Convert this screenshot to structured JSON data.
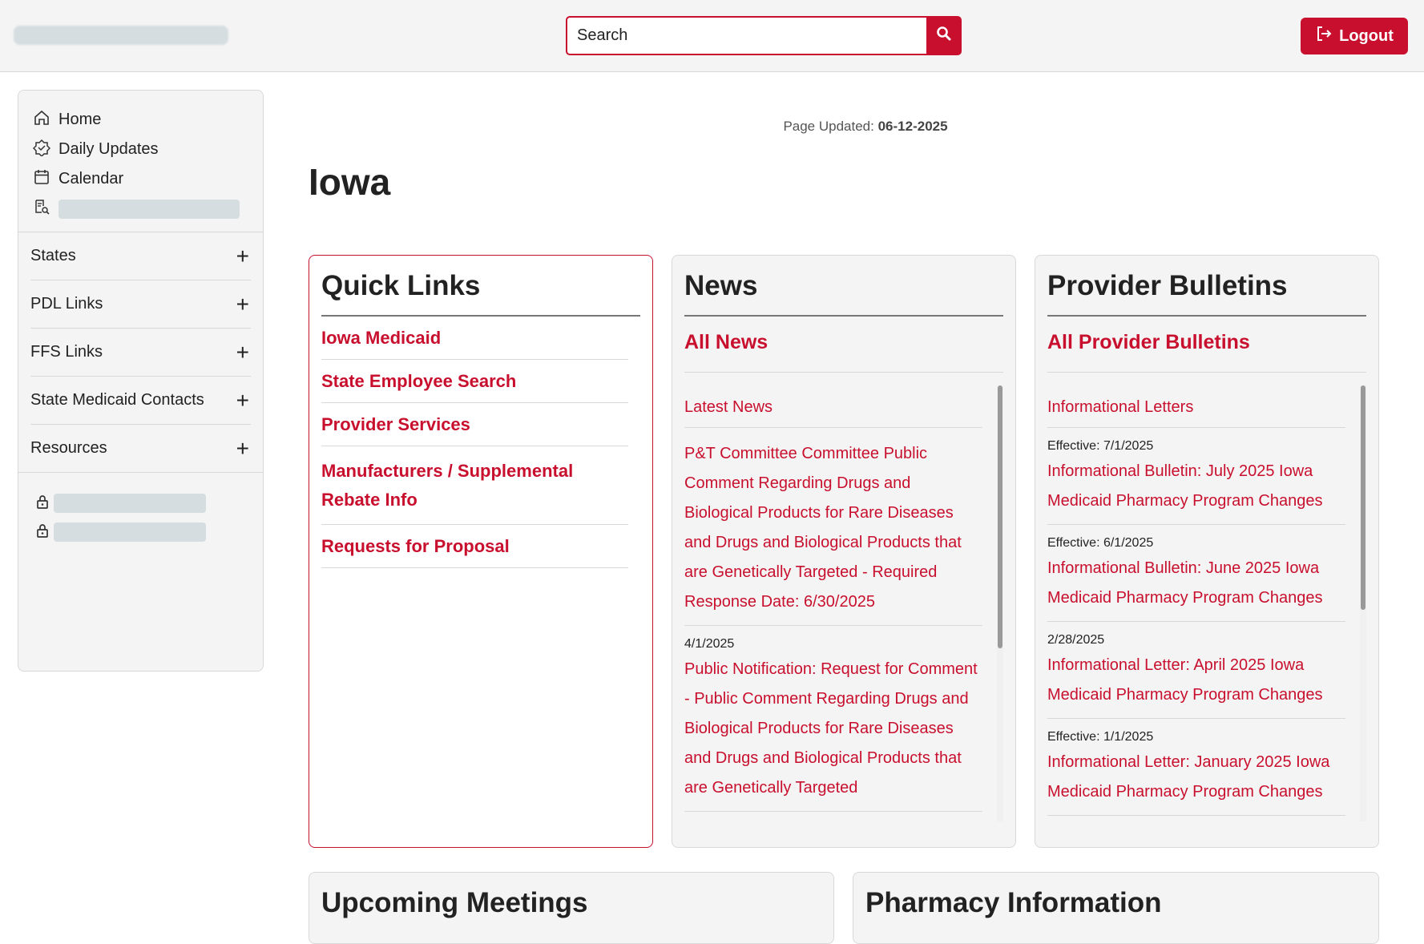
{
  "header": {
    "search_placeholder": "Search",
    "logout_label": "Logout"
  },
  "sidebar": {
    "top_links": [
      {
        "label": "Home",
        "icon": "home-icon"
      },
      {
        "label": "Daily Updates",
        "icon": "badge-icon"
      },
      {
        "label": "Calendar",
        "icon": "calendar-icon"
      }
    ],
    "sections": [
      {
        "label": "States"
      },
      {
        "label": "PDL Links"
      },
      {
        "label": "FFS Links"
      },
      {
        "label": "State Medicaid Contacts"
      },
      {
        "label": "Resources"
      }
    ]
  },
  "main": {
    "page_updated_label": "Page Updated:",
    "page_updated_date": "06-12-2025",
    "title": "Iowa"
  },
  "quick_links": {
    "title": "Quick Links",
    "links": [
      "Iowa Medicaid",
      "State Employee Search",
      "Provider Services",
      "Manufacturers / Supplemental Rebate Info",
      "Requests for Proposal"
    ]
  },
  "news": {
    "title": "News",
    "all_link": "All News",
    "items": [
      {
        "date": "",
        "text": "Latest News"
      },
      {
        "date": "",
        "text": "P&T Committee Committee Public Comment Regarding Drugs and Biological Products for Rare Diseases and Drugs and Biological Products that are Genetically Targeted - Required Response Date: 6/30/2025"
      },
      {
        "date": "4/1/2025",
        "text": "Public Notification: Request for Comment - Public Comment Regarding Drugs and Biological Products for Rare Diseases and Drugs and Biological Products that are Genetically Targeted"
      }
    ]
  },
  "bulletins": {
    "title": "Provider Bulletins",
    "all_link": "All Provider Bulletins",
    "items": [
      {
        "date": "",
        "text": "Informational Letters"
      },
      {
        "date": "Effective: 7/1/2025",
        "text": "Informational Bulletin: July 2025 Iowa Medicaid Pharmacy Program Changes"
      },
      {
        "date": "Effective: 6/1/2025",
        "text": "Informational Bulletin: June 2025 Iowa Medicaid Pharmacy Program Changes"
      },
      {
        "date": "2/28/2025",
        "text": "Informational Letter: April 2025 Iowa Medicaid Pharmacy Program Changes"
      },
      {
        "date": "Effective: 1/1/2025",
        "text": "Informational Letter: January 2025 Iowa Medicaid Pharmacy Program Changes"
      }
    ]
  },
  "bottom_cards": {
    "meetings_title": "Upcoming Meetings",
    "pharmacy_title": "Pharmacy Information"
  },
  "colors": {
    "accent": "#c8102e",
    "panel_bg": "#f4f4f4",
    "border": "#d8d8d8"
  }
}
